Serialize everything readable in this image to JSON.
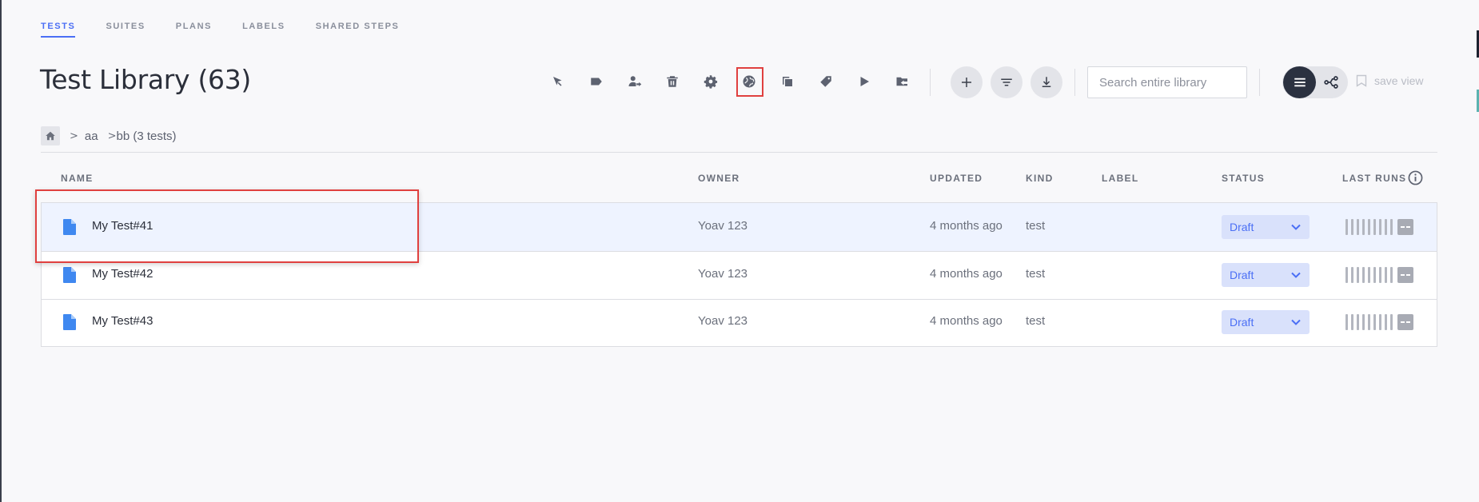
{
  "tabs": [
    {
      "label": "TESTS",
      "active": true
    },
    {
      "label": "SUITES",
      "active": false
    },
    {
      "label": "PLANS",
      "active": false
    },
    {
      "label": "LABELS",
      "active": false
    },
    {
      "label": "SHARED STEPS",
      "active": false
    }
  ],
  "page_title": "Test Library (63)",
  "toolbar": {
    "icons": [
      "move-icon",
      "label-icon",
      "assign-owner-icon",
      "delete-icon",
      "settings-icon",
      "globe-icon",
      "copy-icon",
      "tag-icon",
      "run-icon",
      "folder-move-icon"
    ],
    "highlighted_icon": "globe-icon",
    "add_icon": "plus-icon",
    "filter_icon": "filter-icon",
    "download_icon": "download-icon"
  },
  "search": {
    "placeholder": "Search entire library",
    "value": ""
  },
  "view": {
    "active": "list",
    "save_label": "save view"
  },
  "breadcrumb": {
    "home_icon": "home-icon",
    "items": [
      "aa",
      "bb (3 tests)"
    ]
  },
  "table": {
    "columns": {
      "name": "NAME",
      "owner": "OWNER",
      "updated": "UPDATED",
      "kind": "KIND",
      "label": "LABEL",
      "status": "STATUS",
      "last_runs": "LAST RUNS"
    },
    "rows": [
      {
        "name": "My Test#41",
        "owner": "Yoav 123",
        "updated": "4 months ago",
        "kind": "test",
        "label": "",
        "status": "Draft",
        "selected": true
      },
      {
        "name": "My Test#42",
        "owner": "Yoav 123",
        "updated": "4 months ago",
        "kind": "test",
        "label": "",
        "status": "Draft",
        "selected": false
      },
      {
        "name": "My Test#43",
        "owner": "Yoav 123",
        "updated": "4 months ago",
        "kind": "test",
        "label": "",
        "status": "Draft",
        "selected": false
      }
    ]
  },
  "colors": {
    "accent": "#4b6ff5",
    "highlight": "#e0403f",
    "status_bg": "#d9e1fb",
    "selected_row": "#eef3ff"
  }
}
